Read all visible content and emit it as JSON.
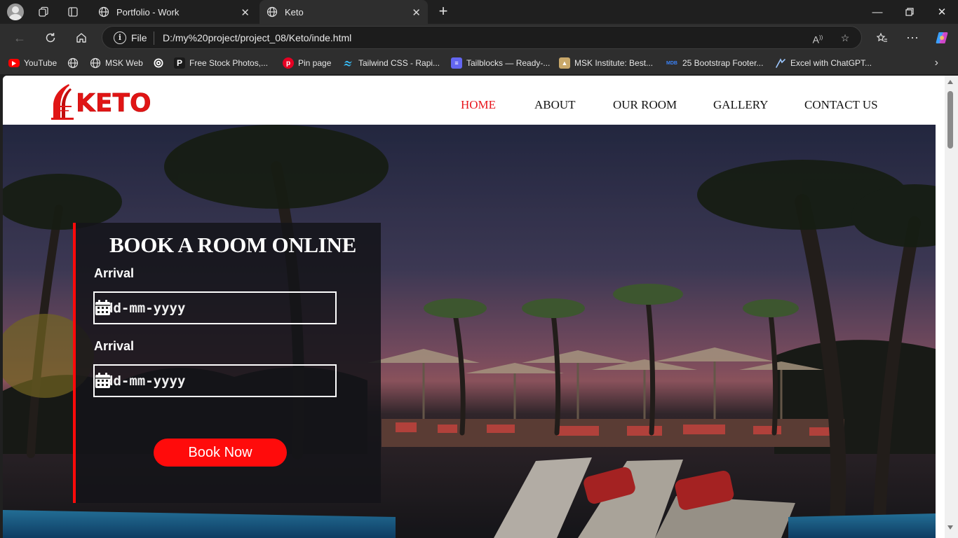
{
  "browser": {
    "tabs": [
      {
        "label": "Portfolio - Work",
        "active": false
      },
      {
        "label": "Keto",
        "active": true
      }
    ],
    "address": {
      "scheme_label": "File",
      "url": "D:/my%20project/project_08/Keto/inde.html"
    },
    "bookmarks": [
      {
        "label": "YouTube",
        "icon": "youtube-icon"
      },
      {
        "label": "",
        "icon": "globe-icon"
      },
      {
        "label": "MSK Web",
        "icon": "globe-icon"
      },
      {
        "label": "",
        "icon": "openai-icon"
      },
      {
        "label": "Free Stock Photos,...",
        "icon": "pexels-icon"
      },
      {
        "label": "Pin page",
        "icon": "pinterest-icon"
      },
      {
        "label": "Tailwind CSS - Rapi...",
        "icon": "tailwind-icon"
      },
      {
        "label": "Tailblocks — Ready-...",
        "icon": "tailblocks-icon"
      },
      {
        "label": "MSK Institute: Best...",
        "icon": "institute-icon"
      },
      {
        "label": "25 Bootstrap Footer...",
        "icon": "mdb-icon",
        "icon_text": "MDB"
      },
      {
        "label": "Excel with ChatGPT...",
        "icon": "excel-chatgpt-icon"
      }
    ]
  },
  "site": {
    "logo_text": "KETO",
    "nav": [
      {
        "label": "HOME",
        "active": true
      },
      {
        "label": "ABOUT",
        "active": false
      },
      {
        "label": "OUR ROOM",
        "active": false
      },
      {
        "label": "GALLERY",
        "active": false
      },
      {
        "label": "CONTACT US",
        "active": false
      }
    ],
    "booking": {
      "title": "BOOK A ROOM ONLINE",
      "fields": [
        {
          "label": "Arrival",
          "placeholder": "dd-mm-yyyy"
        },
        {
          "label": "Arrival",
          "placeholder": "dd-mm-yyyy"
        }
      ],
      "button_label": "Book Now"
    }
  },
  "colors": {
    "accent": "#ff0b0b",
    "nav_active": "#e8141b",
    "chrome_dark": "#1f1f1f",
    "chrome_toolbar": "#2e2e2e"
  }
}
